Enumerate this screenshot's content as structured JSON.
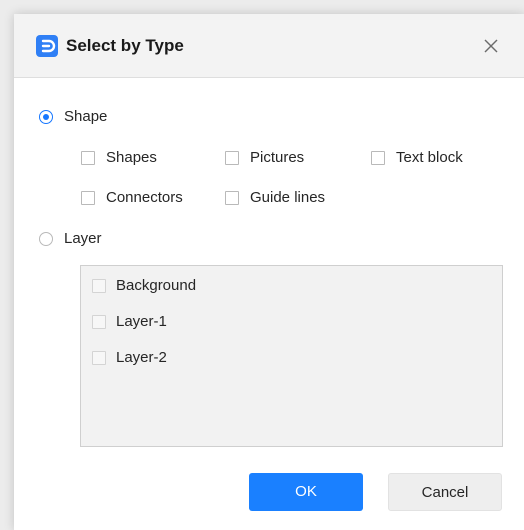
{
  "dialog": {
    "title": "Select by Type",
    "close_icon": "close-icon",
    "app_icon": "app-logo-icon",
    "accent_color": "#1a80ff"
  },
  "shape_option": {
    "label": "Shape",
    "selected": true,
    "checkboxes": [
      {
        "label": "Shapes",
        "checked": false
      },
      {
        "label": "Pictures",
        "checked": false
      },
      {
        "label": "Text block",
        "checked": false
      },
      {
        "label": "Connectors",
        "checked": false
      },
      {
        "label": "Guide lines",
        "checked": false
      }
    ]
  },
  "layer_option": {
    "label": "Layer",
    "selected": false,
    "layers": [
      {
        "label": "Background",
        "checked": false
      },
      {
        "label": "Layer-1",
        "checked": false
      },
      {
        "label": "Layer-2",
        "checked": false
      }
    ]
  },
  "buttons": {
    "ok_label": "OK",
    "cancel_label": "Cancel"
  }
}
